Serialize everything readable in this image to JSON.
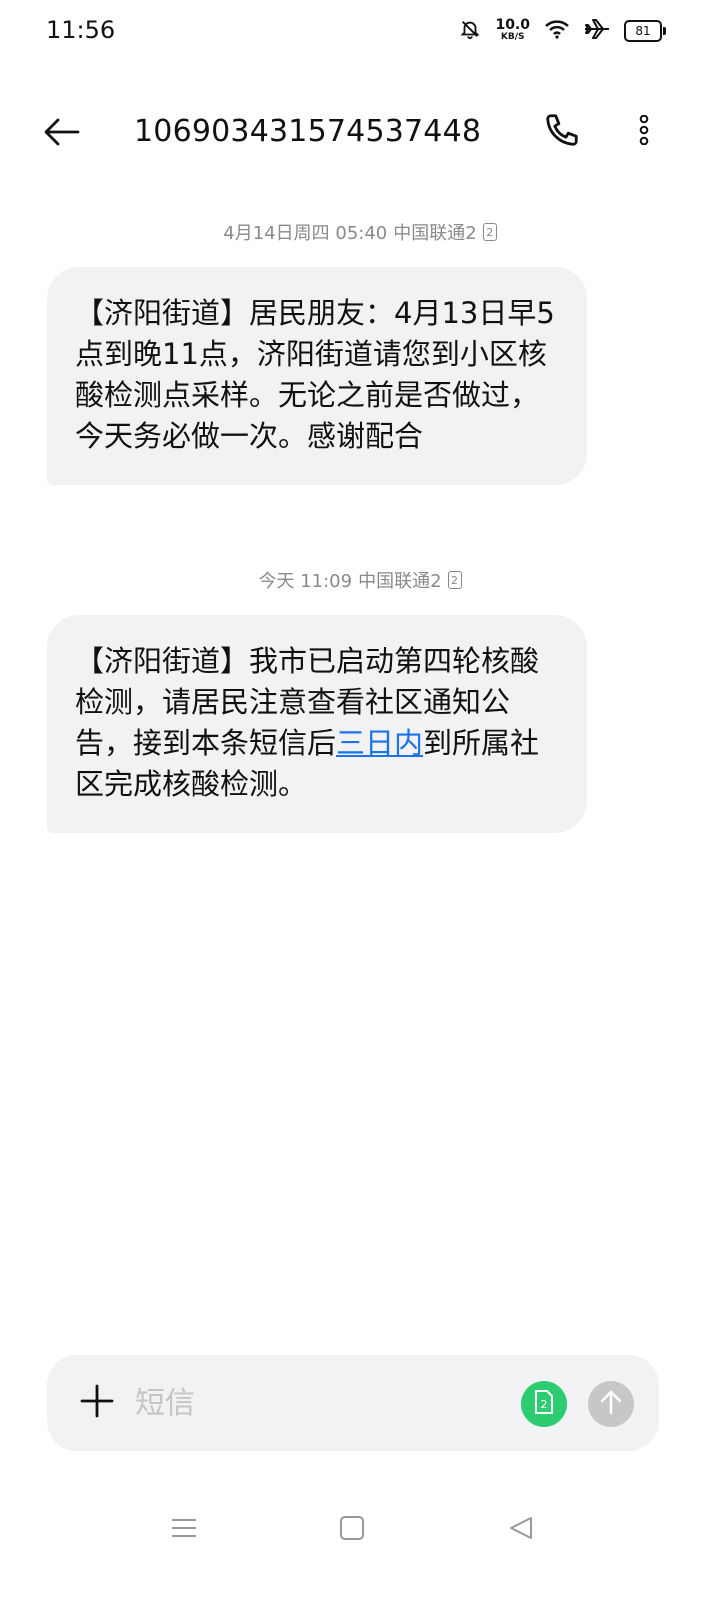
{
  "status_bar": {
    "time": "11:56",
    "speed_value": "10.0",
    "speed_unit": "KB/S",
    "battery": "81",
    "icons": [
      "mute-bell-icon",
      "wifi-icon",
      "airplane-icon",
      "battery-icon"
    ]
  },
  "header": {
    "title": "1069034315745374​48",
    "back_icon": "arrow-left-icon",
    "call_icon": "phone-icon",
    "more_icon": "more-vertical-icon"
  },
  "messages": [
    {
      "timestamp": "4月14日周四 05:40",
      "carrier": "中国联通2",
      "sim": "2",
      "text": "【济阳街道】居民朋友：4月13日早5点到晚11点，济阳街道请您到小区核酸检测点采样。无论之前是否做过，今天务必做一次。感谢配合"
    },
    {
      "timestamp": "今天 11:09",
      "carrier": "中国联通2",
      "sim": "2",
      "text_before": "【济阳街道】我市已启动第四轮核酸检测，请居民注意查看社区通知公告，接到本条短信后",
      "link": "三日内",
      "text_after": "到所属社区完成核酸检测。"
    }
  ],
  "composer": {
    "placeholder": "短信",
    "value": "",
    "sim_label": "2",
    "sim_color": "#2ecc71",
    "send_color": "#c7c7c9"
  },
  "nav_bar": {
    "items": [
      "menu-icon",
      "home-square-icon",
      "back-triangle-icon"
    ]
  }
}
